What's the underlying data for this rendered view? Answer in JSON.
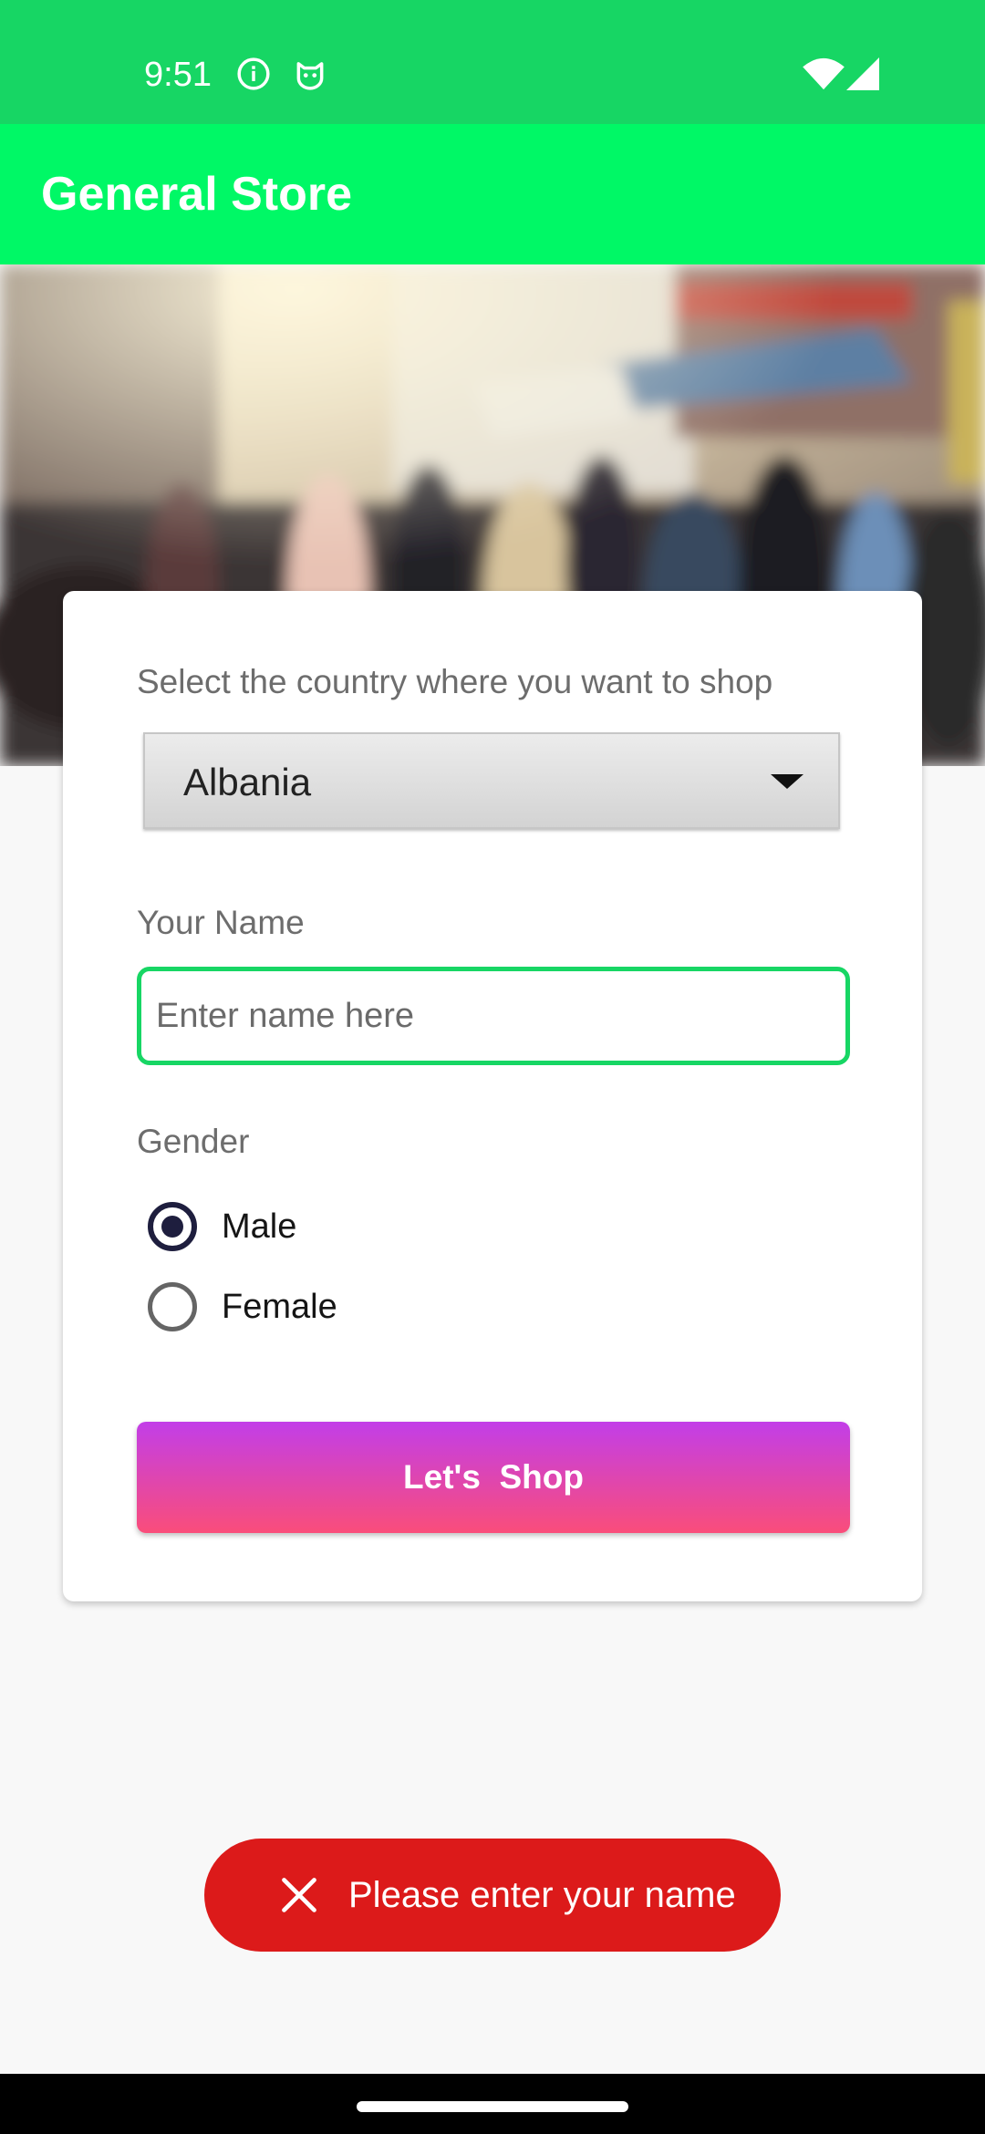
{
  "status_bar": {
    "time": "9:51",
    "left_icons": [
      "info-icon",
      "cat-face-icon"
    ],
    "right_icons": [
      "wifi-icon",
      "cellular-signal-icon"
    ]
  },
  "app_bar": {
    "title": "General Store",
    "color": "#00f866"
  },
  "form": {
    "country_label": "Select the country where you want to shop",
    "country_value": "Albania",
    "name_label": "Your Name",
    "name_value": "",
    "name_placeholder": "Enter name here",
    "gender_label": "Gender",
    "gender_options": [
      {
        "label": "Male",
        "selected": true
      },
      {
        "label": "Female",
        "selected": false
      }
    ],
    "submit_label": "Let's  Shop"
  },
  "toast": {
    "message": "Please enter your name",
    "icon": "close-icon",
    "color": "#dc1a1a"
  },
  "colors": {
    "status_bar": "#17d664",
    "input_border": "#17d664",
    "button_gradient_top": "#c23ee8",
    "button_gradient_bottom": "#fa4d7a",
    "radio_checked": "#1e1e3e"
  }
}
